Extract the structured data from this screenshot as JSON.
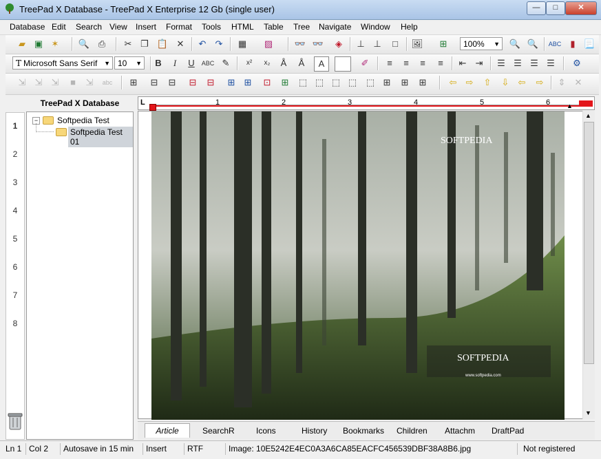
{
  "window": {
    "title": "TreePad X Database - TreePad X Enterprise 12 Gb (single user)"
  },
  "menu": [
    "Database",
    "Edit",
    "Search",
    "View",
    "Insert",
    "Format",
    "Tools",
    "HTML",
    "Table",
    "Tree",
    "Navigate",
    "Window",
    "Help"
  ],
  "toolbar": {
    "zoom_value": "100%",
    "font_name": "Microsoft Sans Serif",
    "font_size": "10",
    "bold": "B",
    "italic": "I",
    "underline": "U",
    "smallcaps": "ABC",
    "superscript": "x²",
    "subscript": "x₂",
    "text_color_glyph": "A",
    "spell_abc": "ABC",
    "abc_dim": "abc"
  },
  "tree": {
    "header": "TreePad X Database",
    "nodes": [
      {
        "label": "Softpedia Test"
      },
      {
        "label": "Softpedia Test 01"
      }
    ]
  },
  "line_numbers": [
    "1",
    "2",
    "3",
    "4",
    "5",
    "6",
    "7",
    "8"
  ],
  "ruler": {
    "labels": [
      "1",
      "2",
      "3",
      "4",
      "5",
      "6"
    ]
  },
  "image": {
    "watermark_top": "SOFTPEDIA",
    "watermark_bottom": "SOFTPEDIA",
    "watermark_url": "www.softpedia.com"
  },
  "tabs": [
    "Article",
    "SearchR",
    "Icons",
    "History",
    "Bookmarks",
    "Children",
    "Attachm",
    "DraftPad"
  ],
  "status": {
    "ln": "Ln 1",
    "col": "Col 2",
    "autosave": "Autosave in 15 min",
    "mode": "Insert",
    "format": "RTF",
    "image_info": "Image: 10E5242E4EC0A3A6CA85EACFC456539DBF38A8B6.jpg",
    "registration": "Not registered"
  },
  "winbuttons": {
    "min": "—",
    "max": "□",
    "close": "✕"
  }
}
